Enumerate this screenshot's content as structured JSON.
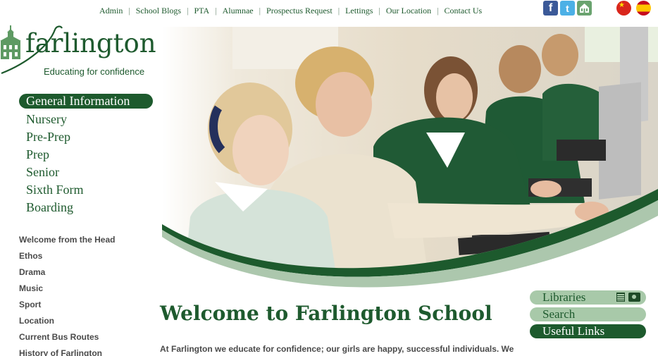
{
  "top_nav": {
    "items": [
      "Admin",
      "School Blogs",
      "PTA",
      "Alumnae",
      "Prospectus Request",
      "Lettings",
      "Our Location",
      "Contact Us"
    ]
  },
  "social": {
    "facebook": "f",
    "twitter": "t"
  },
  "flags": {
    "chinese_glyph": "★"
  },
  "logo": {
    "wordmark": "farlington",
    "tagline": "Educating for confidence"
  },
  "main_menu": {
    "items": [
      "General Information",
      "Nursery",
      "Pre-Prep",
      "Prep",
      "Senior",
      "Sixth Form",
      "Boarding"
    ],
    "active_index": 0
  },
  "sub_menu": {
    "items": [
      "Welcome from the Head",
      "Ethos",
      "Drama",
      "Music",
      "Sport",
      "Location",
      "Current Bus Routes",
      "History of Farlington"
    ]
  },
  "right_links": {
    "libraries": "Libraries",
    "search": "Search",
    "useful_links": "Useful Links"
  },
  "content": {
    "heading": "Welcome to Farlington School",
    "intro": "At Farlington we educate for confidence; our girls are happy, successful individuals. We"
  },
  "colors": {
    "brand_green": "#1d5a2d",
    "light_green": "#a8c9a9",
    "text_grey": "#4a4a4a"
  }
}
